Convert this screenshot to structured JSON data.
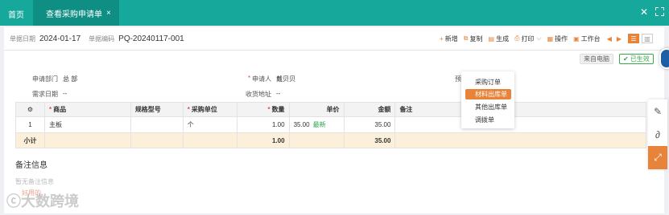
{
  "tabs": {
    "home": "首页",
    "active": "查看采购申请单",
    "close_icon": "×"
  },
  "window": {
    "close": "✕",
    "fullscreen_icon": "fullscreen-icon"
  },
  "header": {
    "date_label": "单据日期",
    "date_value": "2024-01-17",
    "code_label": "单据编码",
    "code_value": "PQ-20240117-001"
  },
  "toolbar": {
    "add": "新增",
    "copy": "复制",
    "generate": "生成",
    "print": "打印",
    "print_caret": "⌵",
    "operate": "操作",
    "workbench": "工作台"
  },
  "badges": {
    "source": "来自电脑",
    "status": "已生效"
  },
  "fields": {
    "dept_label": "申请部门",
    "dept_value": "总 部",
    "applicant_label": "申请人",
    "applicant_value": "戴贝贝",
    "third_label": "预",
    "demand_date_label": "需求日期",
    "demand_date_value": "--",
    "address_label": "收货地址",
    "address_value": "--"
  },
  "table": {
    "headers": {
      "settings_icon": "gear-icon",
      "product": "商品",
      "spec": "规格型号",
      "unit": "采购单位",
      "qty": "数量",
      "price": "单价",
      "amount": "金额",
      "remark": "备注"
    },
    "rows": [
      {
        "no": "1",
        "product": "主板",
        "spec": "",
        "unit": "个",
        "qty": "1.00",
        "price": "35.00",
        "price_tag": "最新",
        "amount": "35.00",
        "remark": ""
      }
    ],
    "total": {
      "label": "小计",
      "qty": "1.00",
      "amount": "35.00"
    }
  },
  "remarks": {
    "title": "备注信息",
    "empty": "暂无备注信息"
  },
  "watermark": {
    "text": "大数跨境",
    "small": "好用的"
  },
  "dropdown": {
    "items": [
      "采购订单",
      "材料出库单",
      "其他出库单",
      "调拨单"
    ],
    "active_index": 1
  },
  "colors": {
    "topbar": "#16a89b",
    "accent": "#e8833a",
    "success": "#38a84a"
  }
}
